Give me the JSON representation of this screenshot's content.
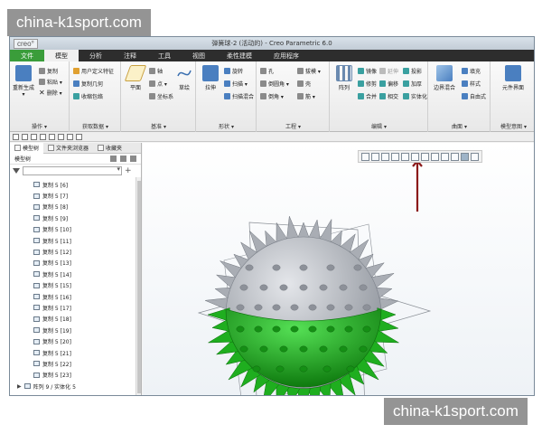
{
  "watermark": {
    "text": "china-k1sport.com"
  },
  "window": {
    "logo": "creo°",
    "title": "弹簧球-2 (活动的) - Creo Parametric 6.0"
  },
  "tabs": [
    {
      "label": "文件"
    },
    {
      "label": "模型"
    },
    {
      "label": "分析"
    },
    {
      "label": "注释"
    },
    {
      "label": "工具"
    },
    {
      "label": "视图"
    },
    {
      "label": "柔性建模"
    },
    {
      "label": "应用程序"
    }
  ],
  "ribbon": {
    "operations": {
      "caption": "操作 ▾",
      "regen": "重新生成 ▾",
      "copy": "复制",
      "paste": "粘贴 ▾",
      "delete": "删除 ▾"
    },
    "get_data": {
      "caption": "获取数据 ▾",
      "udf": "用户定义特征",
      "copy_geom": "复制几何",
      "shrinkwrap": "收缩包络"
    },
    "datum": {
      "caption": "基准 ▾",
      "plane": "平面",
      "axis": "轴",
      "point": "点 ▾",
      "csys": "坐标系",
      "sketch": "草绘"
    },
    "shapes": {
      "caption": "形状 ▾",
      "extrude": "拉伸",
      "revolve": "旋转",
      "sweep": "扫描 ▾",
      "swept_blend": "扫描混合"
    },
    "engineering": {
      "caption": "工程 ▾",
      "hole": "孔",
      "round": "倒圆角 ▾",
      "chamfer": "倒角 ▾",
      "draft": "拔模 ▾",
      "shell": "壳",
      "rib": "筋 ▾"
    },
    "editing": {
      "caption": "编辑 ▾",
      "pattern": "阵列",
      "mirror": "镜像",
      "extend": "延伸",
      "project": "投影",
      "trim": "修剪",
      "offset": "偏移",
      "thicken": "加厚",
      "merge": "合并",
      "intersect": "相交",
      "solidify": "实体化"
    },
    "surfaces": {
      "caption": "曲面 ▾",
      "boundary_blend": "边界混合",
      "fill": "填充",
      "style": "样式",
      "freestyle": "自由式"
    },
    "model_intent": {
      "caption": "模型意图 ▾",
      "component_interface": "元件界面"
    }
  },
  "panel": {
    "tabs": [
      {
        "label": "模型树"
      },
      {
        "label": "文件夹浏览器"
      },
      {
        "label": "收藏夹"
      }
    ],
    "tree_header": "模型树",
    "search_placeholder": "",
    "items": [
      {
        "label": "复制 5 [6]"
      },
      {
        "label": "复制 5 [7]"
      },
      {
        "label": "复制 5 [8]"
      },
      {
        "label": "复制 5 [9]"
      },
      {
        "label": "复制 5 [10]"
      },
      {
        "label": "复制 5 [11]"
      },
      {
        "label": "复制 5 [12]"
      },
      {
        "label": "复制 5 [13]"
      },
      {
        "label": "复制 5 [14]"
      },
      {
        "label": "复制 5 [15]"
      },
      {
        "label": "复制 5 [16]"
      },
      {
        "label": "复制 5 [17]"
      },
      {
        "label": "复制 5 [18]"
      },
      {
        "label": "复制 5 [19]"
      },
      {
        "label": "复制 5 [20]"
      },
      {
        "label": "复制 5 [21]"
      },
      {
        "label": "复制 5 [22]"
      },
      {
        "label": "复制 5 [23]"
      }
    ],
    "pattern_item": "阵列 9 / 实体化 5"
  },
  "colors": {
    "file_tab": "#3a9d3a",
    "model_green": "#22b522",
    "model_gray": "#b9bcc2",
    "arrow": "#8b1a1a"
  }
}
